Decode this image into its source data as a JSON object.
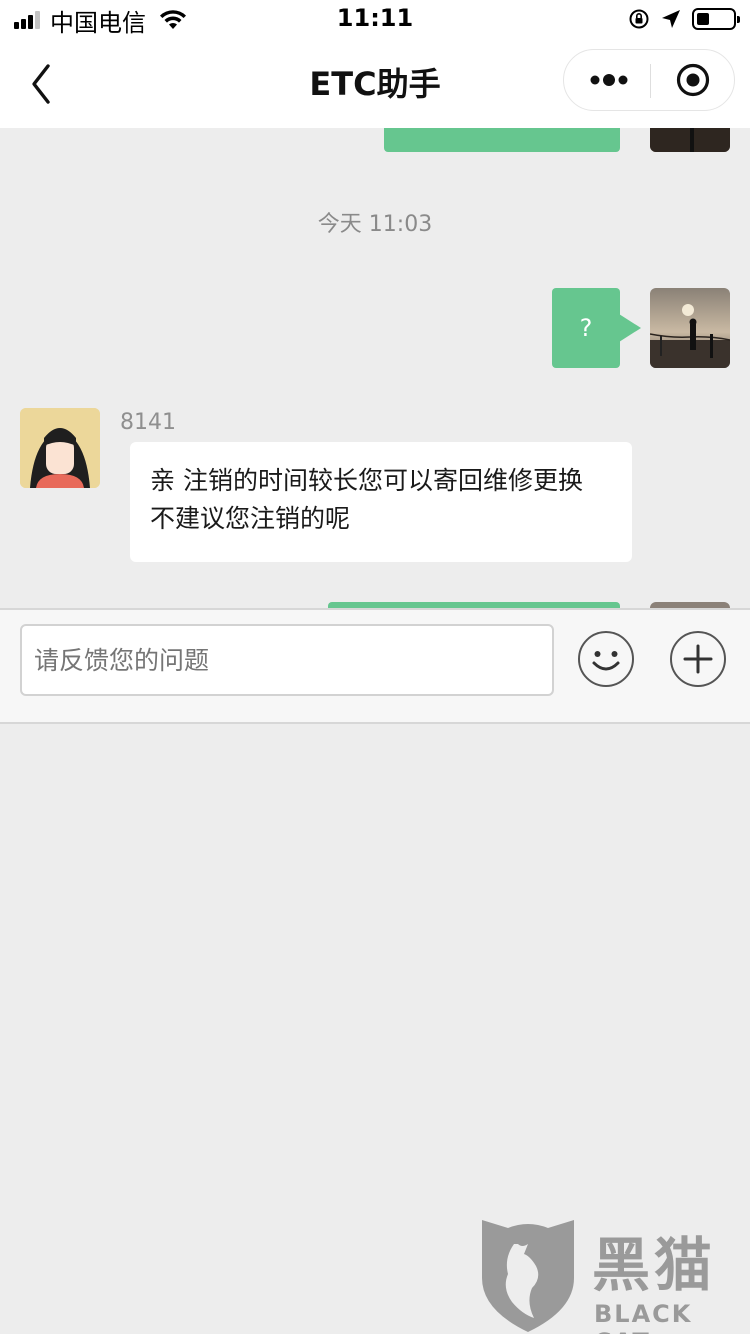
{
  "status_bar": {
    "carrier": "中国电信",
    "time": "11:11",
    "battery_level": 0.35
  },
  "nav": {
    "title": "ETC助手",
    "icons": [
      "back-chevron-icon",
      "more-dots-icon",
      "target-circle-icon"
    ]
  },
  "chat": {
    "timestamp": "今天 11:03",
    "messages": [
      {
        "sender": "self",
        "text": "?"
      },
      {
        "sender": "agent",
        "name": "8141",
        "text": "亲 注销的时间较长您可以寄回维修更换 不建议您注销的呢"
      }
    ]
  },
  "input_bar": {
    "placeholder": "请反馈您的问题",
    "icons": [
      "emoji-icon",
      "plus-icon"
    ]
  },
  "watermark": {
    "chinese": "黑猫",
    "english": "BLACK CAT"
  },
  "colors": {
    "self_bubble": "#66c68f",
    "background": "#ededed"
  }
}
